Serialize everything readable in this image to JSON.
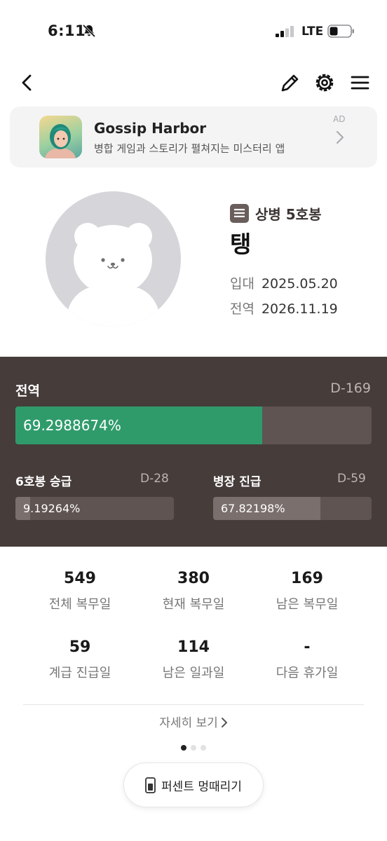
{
  "status_bar": {
    "time": "6:11",
    "network": "LTE"
  },
  "nav": {
    "back_icon": "chevron-left-icon",
    "edit_icon": "pencil-icon",
    "settings_icon": "gear-icon",
    "menu_icon": "hamburger-icon"
  },
  "ad": {
    "title": "Gossip Harbor",
    "subtitle": "병합 게임과 스토리가 펼쳐지는 미스터리 앱",
    "tag": "AD"
  },
  "profile": {
    "rank": "상병 5호봉",
    "name": "탱",
    "enlist_label": "입대",
    "enlist_date": "2025.05.20",
    "discharge_label": "전역",
    "discharge_date": "2026.11.19"
  },
  "progress": {
    "discharge": {
      "title": "전역",
      "dday": "D-169",
      "percent_text": "69.2988674%",
      "percent": 69.2988674
    },
    "promotion_step": {
      "title": "6호봉 승급",
      "dday": "D-28",
      "percent_text": "9.19264%",
      "percent": 9.19264
    },
    "promotion_rank": {
      "title": "병장 진급",
      "dday": "D-59",
      "percent_text": "67.82198%",
      "percent": 67.82198
    }
  },
  "stats": [
    {
      "value": "549",
      "label": "전체 복무일"
    },
    {
      "value": "380",
      "label": "현재 복무일"
    },
    {
      "value": "169",
      "label": "남은 복무일"
    },
    {
      "value": "59",
      "label": "계급 진급일"
    },
    {
      "value": "114",
      "label": "남은 일과일"
    },
    {
      "value": "-",
      "label": "다음 휴가일"
    }
  ],
  "more_label": "자세히 보기",
  "pager": {
    "total": 3,
    "active": 0
  },
  "float_button_label": "퍼센트 멍때리기",
  "colors": {
    "panel_bg": "#463c3a",
    "bar_track": "#5f5452",
    "bar_accent": "#2f9b6b",
    "bar_sub": "#7a6f6d"
  }
}
